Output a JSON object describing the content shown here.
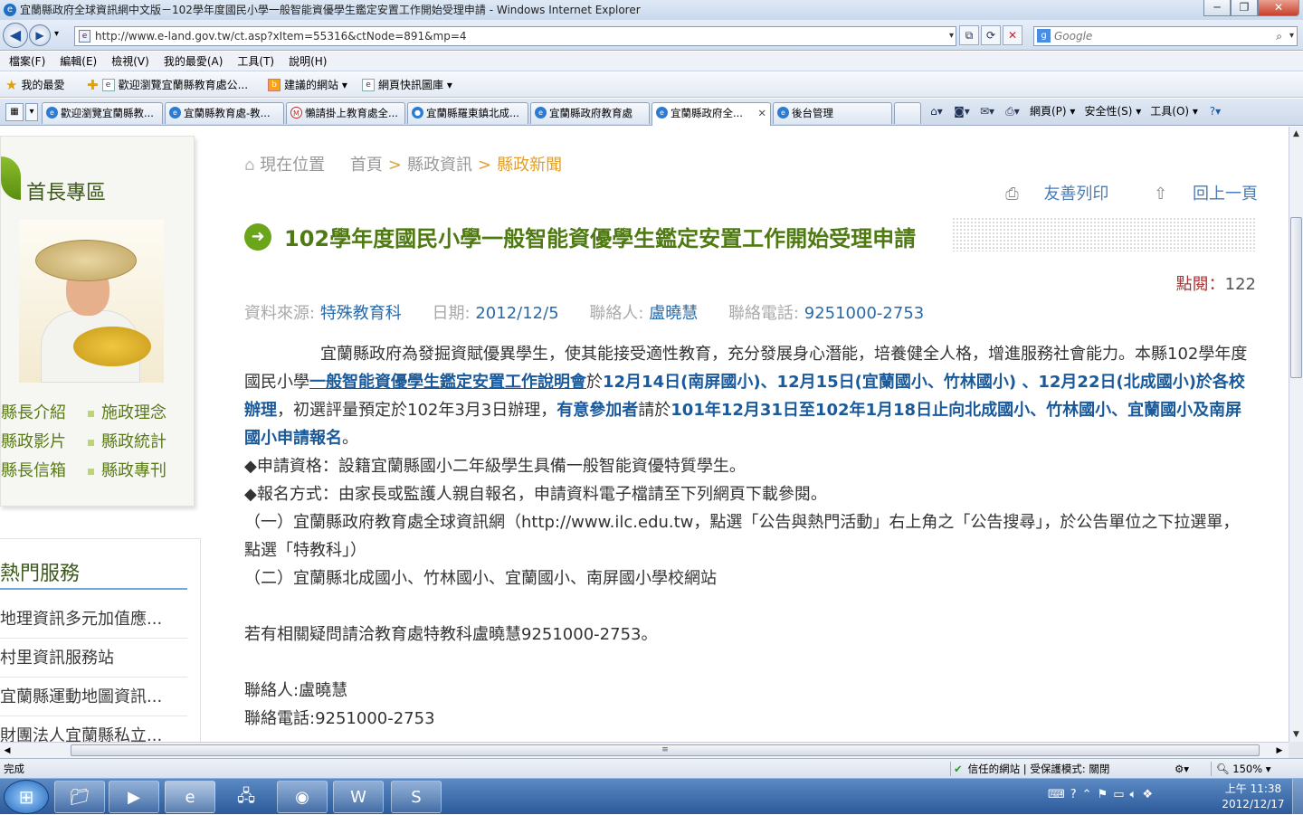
{
  "window": {
    "title": "宜蘭縣政府全球資訊網中文版－102學年度國民小學一般智能資優學生鑑定安置工作開始受理申請 - Windows Internet Explorer"
  },
  "address": {
    "url": "http://www.e-land.gov.tw/ct.asp?xItem=55316&ctNode=891&mp=4",
    "search_placeholder": "Google"
  },
  "menu": [
    "檔案(F)",
    "編輯(E)",
    "檢視(V)",
    "我的最愛(A)",
    "工具(T)",
    "說明(H)"
  ],
  "favorites": {
    "label": "我的最愛",
    "items": [
      "歡迎瀏覽宜蘭縣教育處公...",
      "建議的網站 ▾",
      "網頁快訊圖庫 ▾"
    ]
  },
  "tabs": [
    {
      "label": "歡迎瀏覽宜蘭縣教..."
    },
    {
      "label": "宜蘭縣教育處-教..."
    },
    {
      "label": "懶請掛上教育處全..."
    },
    {
      "label": "宜蘭縣羅東鎮北成..."
    },
    {
      "label": "宜蘭縣政府教育處"
    },
    {
      "label": "宜蘭縣政府全..."
    },
    {
      "label": "後台管理"
    }
  ],
  "commands": [
    "網頁(P) ▾",
    "安全性(S) ▾",
    "工具(O) ▾"
  ],
  "sidebar": {
    "chief_title": "首長專區",
    "links": [
      "縣長介紹",
      "施政理念",
      "縣政影片",
      "縣政統計",
      "縣長信箱",
      "縣政專刊"
    ],
    "hot_title": "熱門服務",
    "hot_items": [
      "地理資訊多元加值應...",
      "村里資訊服務站",
      "宜蘭縣運動地圖資訊...",
      "財團法人宜蘭縣私立..."
    ]
  },
  "breadcrumb": {
    "label": "現在位置",
    "items": [
      "首頁",
      "縣政資訊",
      "縣政新聞"
    ]
  },
  "tools": {
    "print": "友善列印",
    "back": "回上一頁"
  },
  "article": {
    "title": "102學年度國民小學一般智能資優學生鑑定安置工作開始受理申請",
    "views_label": "點閱：",
    "views": "122",
    "source_label": "資料來源:",
    "source": "特殊教育科",
    "date_label": "日期:",
    "date": "2012/12/5",
    "contact_label": "聯絡人:",
    "contact": "盧曉慧",
    "phone_label": "聯絡電話:",
    "phone": "9251000-2753",
    "p1_a": "宜蘭縣政府為發掘資賦優異學生，使其能接受適性教育，充分發展身心潛能，培養健全人格，增進服務社會能力。本縣102學年度國民小學",
    "p1_link": "一般智能資優學生鑑定安置工作說明會",
    "p1_b": "於",
    "p1_c": "12月14日(南屏國小)、12月15日(宜蘭國小、竹林國小) 、12月22日(北成國小)於各校辦理",
    "p1_d": "，初選評量預定於102年3月3日辦理，",
    "p1_e": "有意參加者",
    "p1_f": "請於",
    "p1_g": "101年12月31日至102年1月18日止向北成國小、竹林國小、宜蘭國小及南屏國小申請報名",
    "p1_h": "。",
    "p2": "◆申請資格：設籍宜蘭縣國小二年級學生具備一般智能資優特質學生。",
    "p3": "◆報名方式：由家長或監護人親自報名，申請資料電子檔請至下列網頁下載參閱。",
    "p4": "（一）宜蘭縣政府教育處全球資訊網（http://www.ilc.edu.tw，點選「公告與熱門活動」右上角之「公告搜尋」，於公告單位之下拉選單，點選「特教科」）",
    "p5": "（二）宜蘭縣北成國小、竹林國小、宜蘭國小、南屏國小學校網站",
    "p6": "若有相關疑問請洽教育處特教科盧曉慧9251000-2753。",
    "p7": "聯絡人:盧曉慧",
    "p8": "聯絡電話:9251000-2753"
  },
  "status": {
    "text": "完成",
    "zone": "信任的網站 | 受保護模式: 關閉",
    "zoom": "150%"
  },
  "clock": {
    "time": "上午 11:38",
    "date": "2012/12/17"
  }
}
